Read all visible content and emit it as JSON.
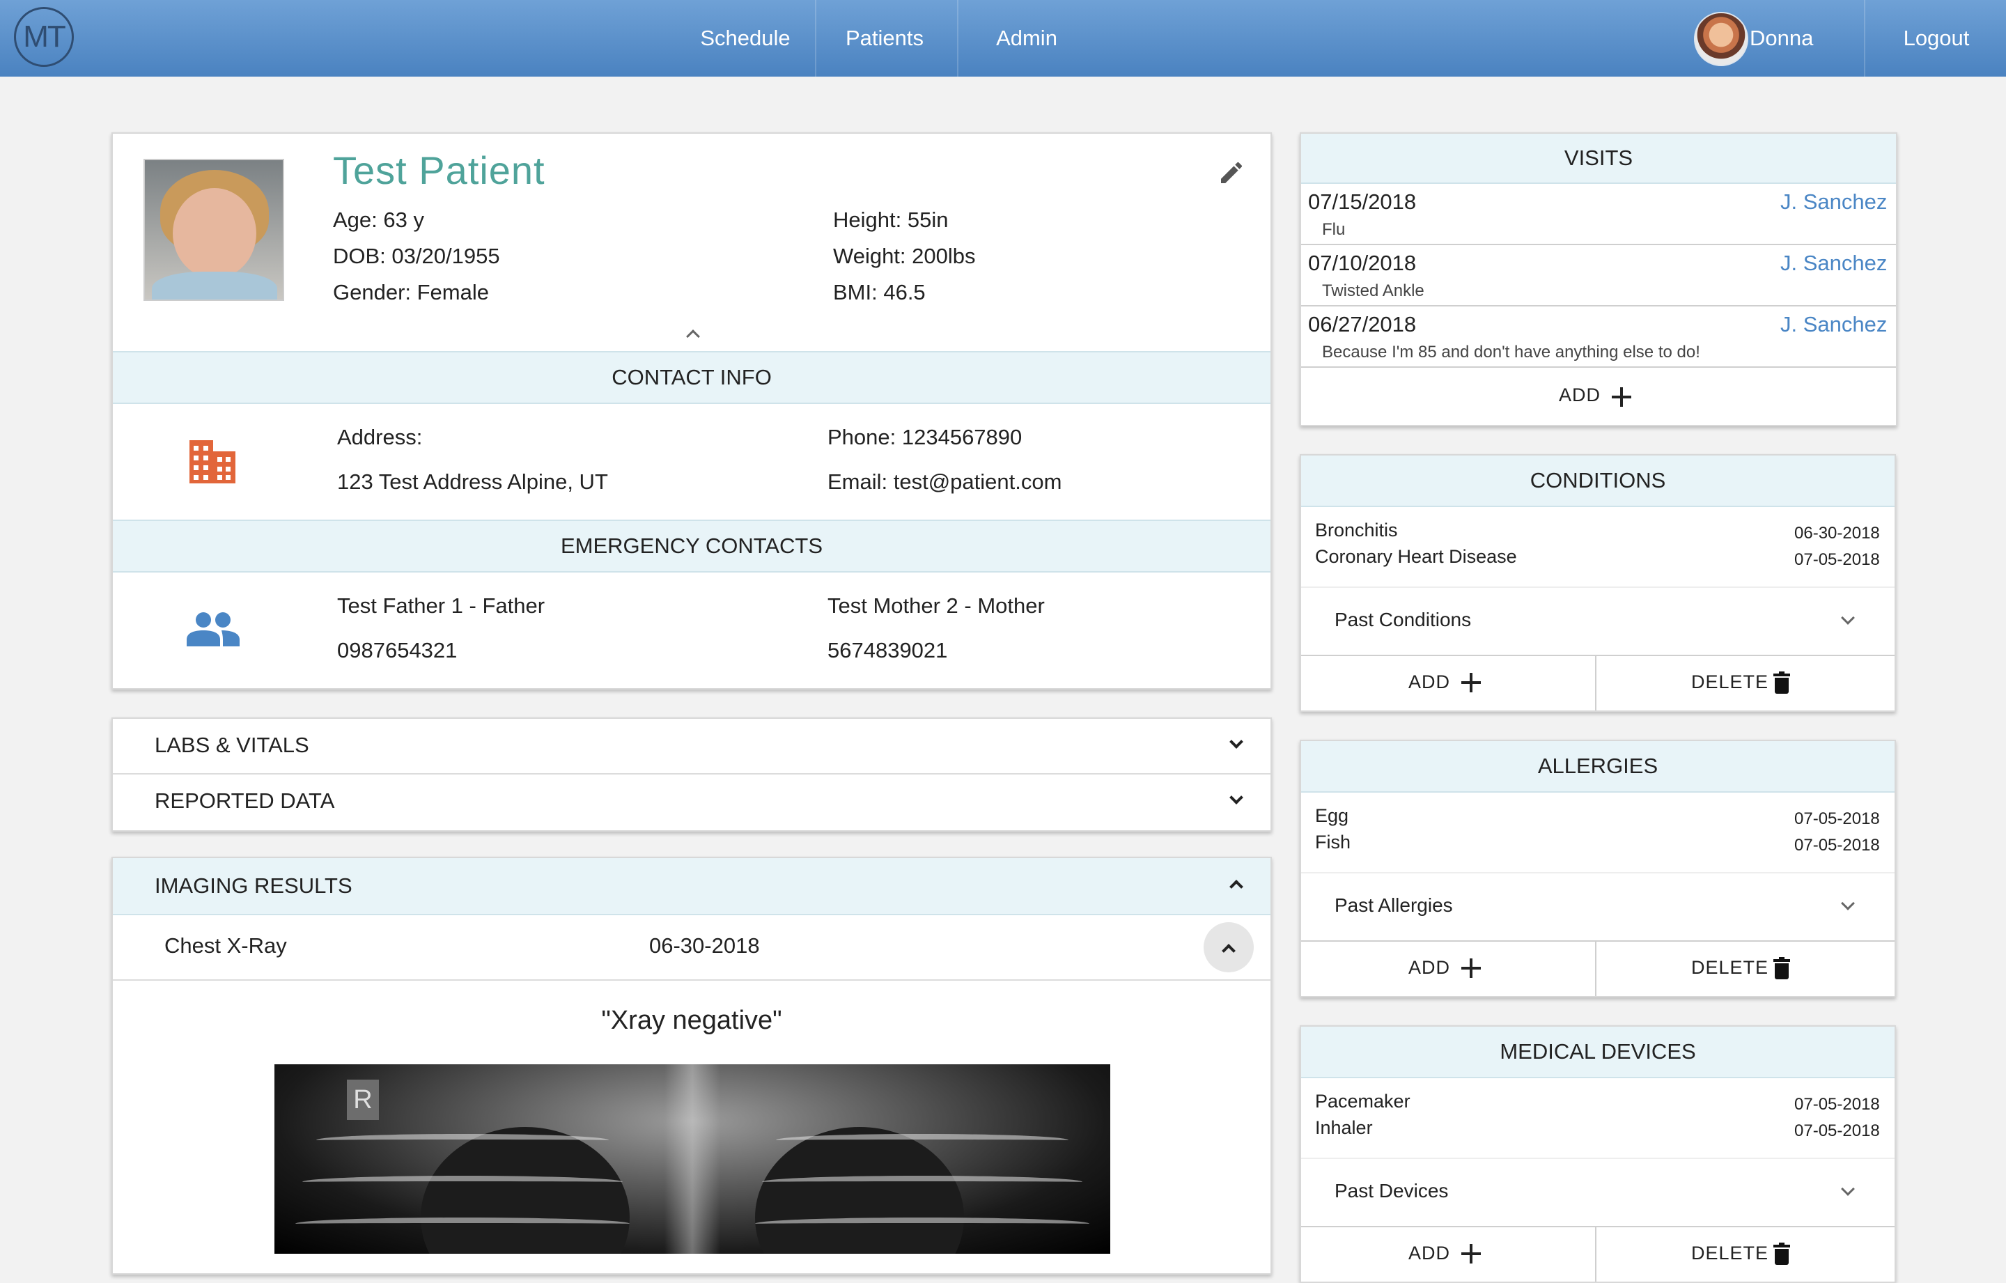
{
  "nav": {
    "logo_text": "MT",
    "items": [
      "Schedule",
      "Patients",
      "Admin"
    ],
    "user_name": "Donna",
    "logout_label": "Logout"
  },
  "patient": {
    "name": "Test Patient",
    "age": "Age: 63 y",
    "dob": "DOB: 03/20/1955",
    "gender": "Gender: Female",
    "height": "Height: 55in",
    "weight": "Weight: 200lbs",
    "bmi": "BMI: 46.5"
  },
  "contact": {
    "header": "CONTACT INFO",
    "address_label": "Address:",
    "address_value": "123 Test Address Alpine, UT",
    "phone": "Phone: 1234567890",
    "email": "Email: test@patient.com"
  },
  "emergency": {
    "header": "EMERGENCY CONTACTS",
    "contacts": [
      {
        "name": "Test Father 1 - Father",
        "phone": "0987654321"
      },
      {
        "name": "Test Mother 2 - Mother",
        "phone": "5674839021"
      }
    ]
  },
  "collapsibles": {
    "labs": "LABS & VITALS",
    "reported": "REPORTED DATA"
  },
  "imaging": {
    "header": "IMAGING RESULTS",
    "study": "Chest X-Ray",
    "date": "06-30-2018",
    "note": "\"Xray negative\"",
    "marker": "R"
  },
  "visits": {
    "header": "VISITS",
    "items": [
      {
        "date": "07/15/2018",
        "doctor": "J. Sanchez",
        "reason": "Flu"
      },
      {
        "date": "07/10/2018",
        "doctor": "J. Sanchez",
        "reason": "Twisted Ankle"
      },
      {
        "date": "06/27/2018",
        "doctor": "J. Sanchez",
        "reason": "Because I'm 85 and don't have anything else to do!"
      }
    ],
    "add_label": "ADD"
  },
  "conditions": {
    "header": "CONDITIONS",
    "items": [
      {
        "name": "Bronchitis",
        "date": "06-30-2018"
      },
      {
        "name": "Coronary Heart Disease",
        "date": "07-05-2018"
      }
    ],
    "past_label": "Past Conditions",
    "add_label": "ADD",
    "delete_label": "DELETE"
  },
  "allergies": {
    "header": "ALLERGIES",
    "items": [
      {
        "name": "Egg",
        "date": "07-05-2018"
      },
      {
        "name": "Fish",
        "date": "07-05-2018"
      }
    ],
    "past_label": "Past Allergies",
    "add_label": "ADD",
    "delete_label": "DELETE"
  },
  "devices": {
    "header": "MEDICAL DEVICES",
    "items": [
      {
        "name": "Pacemaker",
        "date": "07-05-2018"
      },
      {
        "name": "Inhaler",
        "date": "07-05-2018"
      }
    ],
    "past_label": "Past Devices",
    "add_label": "ADD",
    "delete_label": "DELETE"
  },
  "colors": {
    "nav_gradient_top": "#6fa1d6",
    "nav_gradient_bottom": "#4a82c0",
    "patient_name": "#4fa39a",
    "section_header_bg": "#e8f4f8",
    "link": "#4a86c5",
    "building_icon": "#e2663a",
    "people_icon": "#4a86c5"
  },
  "icons": [
    "logo",
    "user-avatar",
    "pencil-icon",
    "building-icon",
    "people-icon",
    "chevron-down-icon",
    "chevron-up-icon",
    "plus-icon",
    "trash-icon"
  ]
}
